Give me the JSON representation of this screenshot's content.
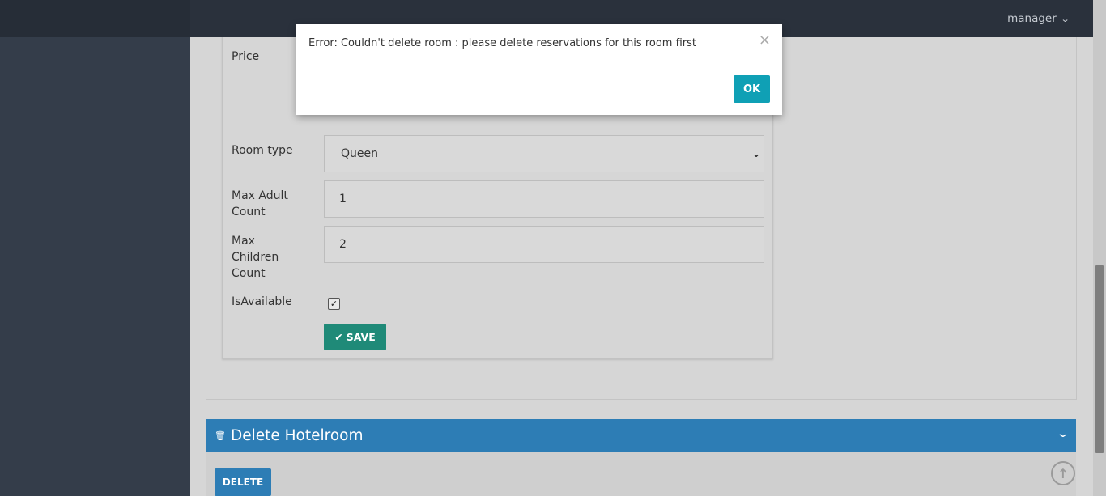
{
  "topbar": {
    "user_label": "manager",
    "user_chevron_icon": "chevron-down-icon"
  },
  "form": {
    "price_label": "Price",
    "room_type_label": "Room type",
    "room_type_value": "Queen",
    "max_adult_label_line1": "Max Adult",
    "max_adult_label_line2": "Count",
    "max_adult_value": "1",
    "max_children_label_line1": "Max",
    "max_children_label_line2": "Children",
    "max_children_label_line3": "Count",
    "max_children_value": "2",
    "is_available_label": "IsAvailable",
    "is_available_checked": true,
    "save_label": "SAVE"
  },
  "delete_panel": {
    "title": "Delete Hotelroom",
    "delete_label": "DELETE"
  },
  "modal": {
    "message": "Error: Couldn't delete room : please delete reservations for this room first",
    "ok_label": "OK"
  },
  "colors": {
    "navbar": "#2a313c",
    "sidebar": "#343d4a",
    "save_button": "#1f8a78",
    "panel_header": "#2d7db5",
    "ok_button": "#0fa0b5"
  }
}
